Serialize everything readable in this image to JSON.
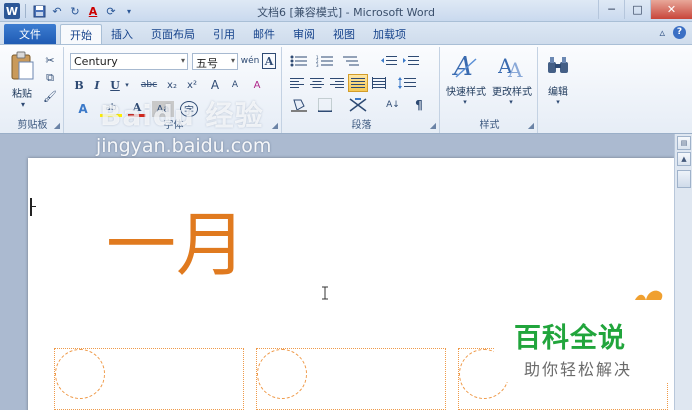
{
  "window": {
    "title": "文档6 [兼容模式] - Microsoft Word",
    "controls": {
      "minimize": "─",
      "maximize": "□",
      "close": "✕"
    }
  },
  "qat": {
    "save": "💾",
    "undo": "↶",
    "redo": "↻",
    "font_color": "A",
    "pen": "⟳",
    "more": "▾"
  },
  "tabs": {
    "file": "文件",
    "items": [
      "开始",
      "插入",
      "页面布局",
      "引用",
      "邮件",
      "审阅",
      "视图",
      "加载项"
    ],
    "active_index": 0,
    "help_minimize": "▵",
    "help": "?"
  },
  "ribbon": {
    "clipboard": {
      "paste": "粘贴",
      "label": "剪贴板",
      "cut": "✂",
      "copy": "⧉",
      "format_painter": "🖌"
    },
    "font": {
      "label": "字体",
      "font_name": "Century",
      "font_size": "五号",
      "grow": "A",
      "shrink": "A",
      "clear": "A",
      "phonetic": "wén",
      "border_char": "A",
      "bold": "B",
      "italic": "I",
      "underline": "U",
      "strike": "abc",
      "subscript": "x₂",
      "superscript": "x²",
      "text_effect": "A",
      "highlight": "ab",
      "font_color": "A",
      "char_shade": "Aa",
      "enclose": "字"
    },
    "paragraph": {
      "label": "段落",
      "sort": "A↓",
      "show_marks": "¶"
    },
    "styles": {
      "label": "样式",
      "quick": "快速样式",
      "change": "更改样式"
    },
    "editing": {
      "label": "编辑",
      "find": "编辑"
    }
  },
  "watermark": {
    "logo": "Baidu 经验",
    "url": "jingyan.baidu.com"
  },
  "document": {
    "month": "一月"
  },
  "brand": {
    "title": "百科全说",
    "subtitle": "助你轻松解决"
  }
}
